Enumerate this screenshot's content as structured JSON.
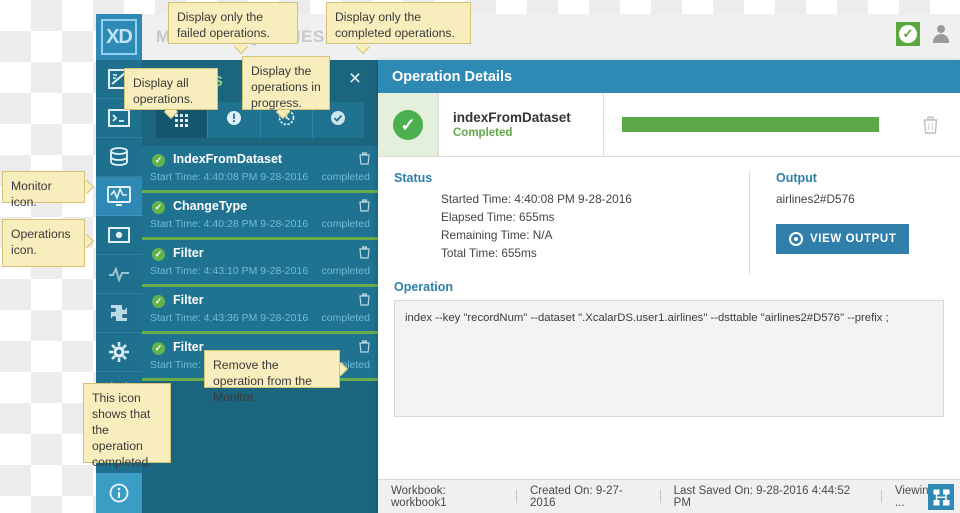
{
  "header": {
    "title": "MONITOR/QUERIES",
    "logo_text": "XD",
    "status_icon": "check-badge-icon",
    "user_icon": "user-icon"
  },
  "sidebar": {
    "items": [
      {
        "name": "worksheet-icon"
      },
      {
        "name": "console-icon"
      },
      {
        "name": "datastore-icon"
      },
      {
        "name": "monitor-icon"
      },
      {
        "name": "operations-icon"
      },
      {
        "name": "pulse-icon"
      },
      {
        "name": "extensions-icon"
      },
      {
        "name": "settings-icon"
      },
      {
        "name": "tools-icon"
      }
    ],
    "bottom_item": {
      "name": "info-icon"
    }
  },
  "queries_panel": {
    "title": "Queries",
    "close_label": "×",
    "tabs": [
      {
        "name": "all-operations-tab",
        "icon": "grid-dots-icon",
        "selected": true
      },
      {
        "name": "failed-operations-tab",
        "icon": "exclamation-icon",
        "selected": false
      },
      {
        "name": "in-progress-operations-tab",
        "icon": "clock-icon",
        "selected": false
      },
      {
        "name": "completed-operations-tab",
        "icon": "check-icon",
        "selected": false
      }
    ],
    "rows": [
      {
        "name": "IndexFromDataset",
        "start": "Start Time: 4:40:08 PM 9-28-2016",
        "status": "completed"
      },
      {
        "name": "ChangeType",
        "start": "Start Time: 4:40:28 PM 9-28-2016",
        "status": "completed"
      },
      {
        "name": "Filter",
        "start": "Start Time: 4:43:10 PM 9-28-2016",
        "status": "completed"
      },
      {
        "name": "Filter",
        "start": "Start Time: 4:43:36 PM 9-28-2016",
        "status": "completed"
      },
      {
        "name": "Filter",
        "start": "Start Time: 4:",
        "status": "completed"
      }
    ]
  },
  "details": {
    "panel_title": "Operation Details",
    "op_name": "indexFromDataset",
    "op_state": "Completed",
    "progress_percent": 100,
    "status": {
      "heading": "Status",
      "started": "Started Time: 4:40:08 PM 9-28-2016",
      "elapsed": "Elapsed Time: 655ms",
      "remaining": "Remaining Time: N/A",
      "total": "Total Time: 655ms"
    },
    "output": {
      "heading": "Output",
      "value": "airlines2#D576",
      "button_label": "VIEW OUTPUT"
    },
    "operation": {
      "heading": "Operation",
      "command": "index --key \"recordNum\" --dataset \".XcalarDS.user1.airlines\" --dsttable \"airlines2#D576\" --prefix ;"
    }
  },
  "statusbar": {
    "workbook": "Workbook: workbook1",
    "created": "Created On: 9-27-2016",
    "saved": "Last Saved On: 9-28-2016 4:44:52 PM",
    "viewing": "Viewing ...",
    "icon": "dataflow-icon"
  },
  "callouts": {
    "failed": "Display only the failed operations.",
    "completed": "Display only the completed operations.",
    "all": "Display all operations.",
    "in_progress": "Display the operations in progress.",
    "monitor_icon": "Monitor icon.",
    "operations_icon": "Operations icon.",
    "remove_op": "Remove the operation from the Monitor.",
    "this_icon": "This icon shows that the operation completed."
  },
  "colors": {
    "brand_blue": "#2f89b5",
    "panel_blue": "#1b657f",
    "green": "#5aa846",
    "callout_bg": "#f7edbd"
  }
}
